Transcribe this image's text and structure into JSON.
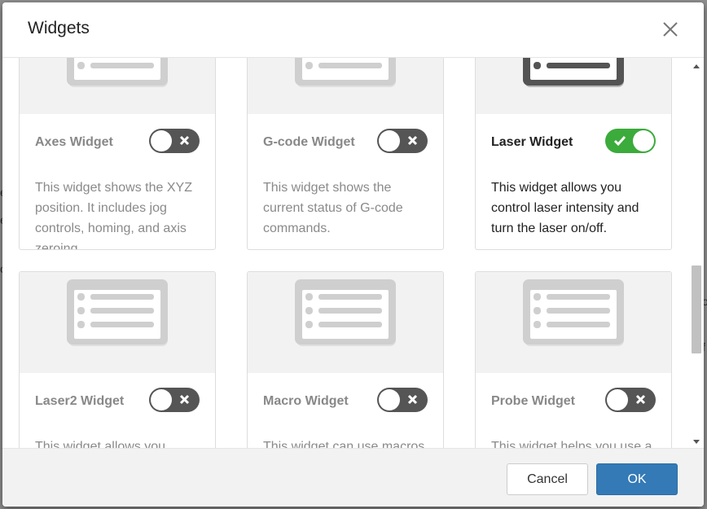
{
  "dialog": {
    "title": "Widgets",
    "close_icon": "close-icon",
    "ok_label": "OK",
    "cancel_label": "Cancel"
  },
  "backdrop": {
    "fragments": [
      "e",
      "e",
      "o",
      "o",
      "f"
    ]
  },
  "widgets": [
    {
      "name": "Axes Widget",
      "enabled": false,
      "description": "This widget shows the XYZ position. It includes jog controls, homing, and axis zeroing."
    },
    {
      "name": "G-code Widget",
      "enabled": false,
      "description": "This widget shows the current status of G-code commands."
    },
    {
      "name": "Laser Widget",
      "enabled": true,
      "description": "This widget allows you control laser intensity and turn the laser on/off."
    },
    {
      "name": "Laser2 Widget",
      "enabled": false,
      "description": "This widget allows you"
    },
    {
      "name": "Macro Widget",
      "enabled": false,
      "description": "This widget can use macros"
    },
    {
      "name": "Probe Widget",
      "enabled": false,
      "description": "This widget helps you use a"
    }
  ],
  "colors": {
    "primary": "#337ab7",
    "toggle_on": "#3bab3b",
    "toggle_off": "#555555"
  }
}
